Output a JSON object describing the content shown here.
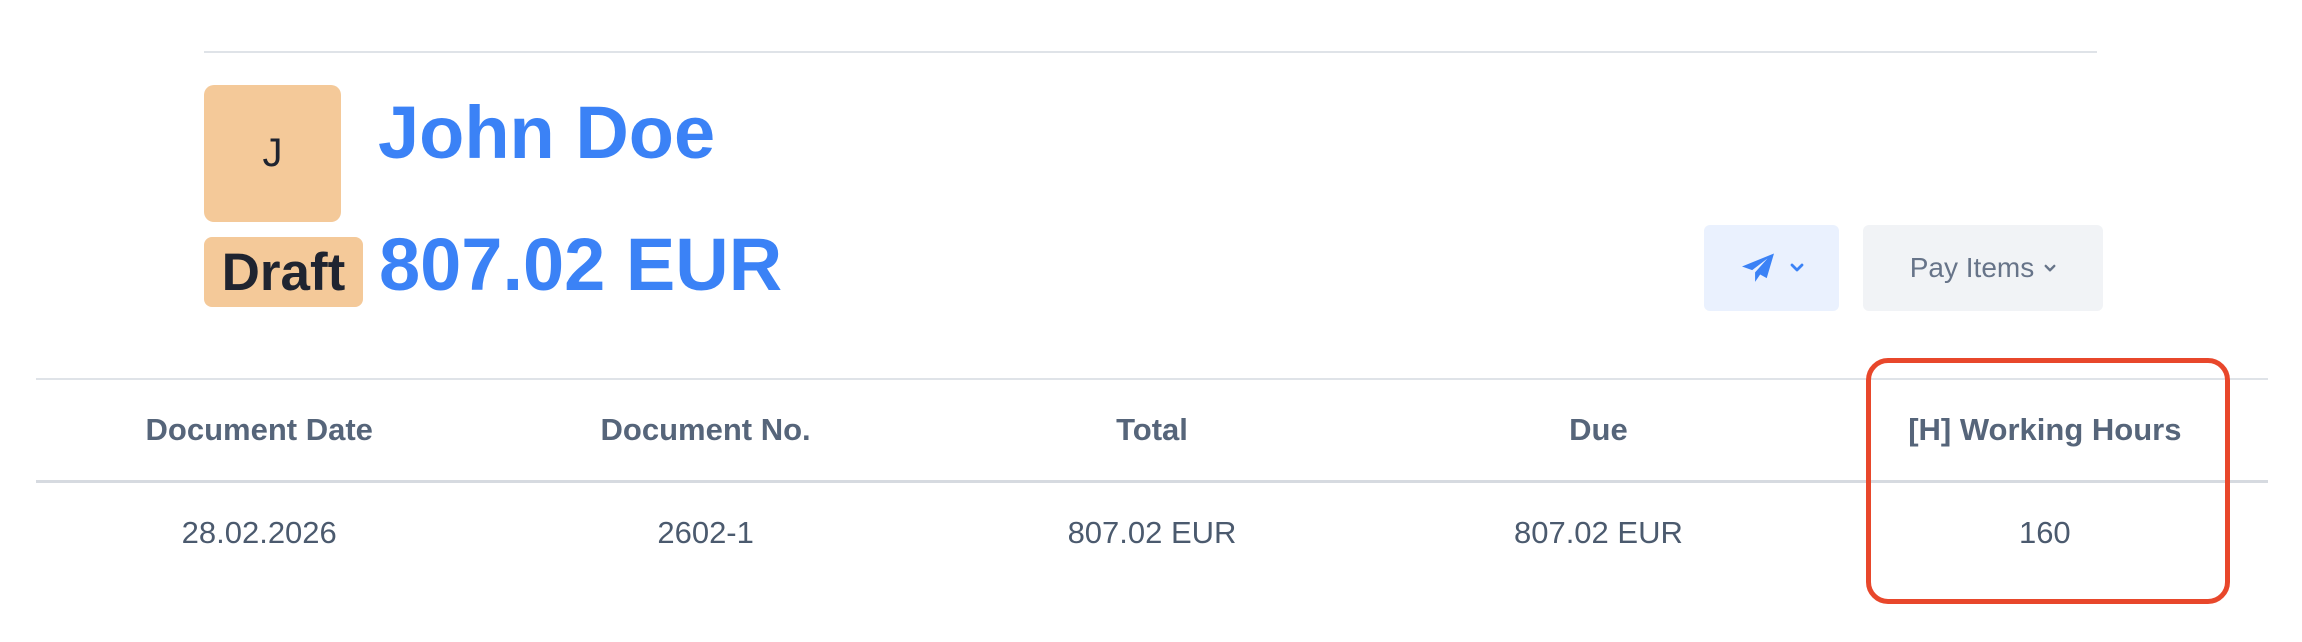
{
  "invoice": {
    "avatar_initial": "J",
    "client_name": "John Doe",
    "status": "Draft",
    "amount": "807.02 EUR"
  },
  "actions": {
    "send_icon": "paper-plane-icon",
    "send_dropdown_icon": "chevron-down-icon",
    "pay_items_label": "Pay Items",
    "pay_items_dropdown_icon": "chevron-down-icon"
  },
  "table": {
    "headers": [
      "Document Date",
      "Document No.",
      "Total",
      "Due",
      "[H] Working Hours"
    ],
    "rows": [
      [
        "28.02.2026",
        "2602-1",
        "807.02 EUR",
        "807.02 EUR",
        "160"
      ]
    ]
  },
  "colors": {
    "accent": "#3b82f6",
    "badge_bg": "#f4c999",
    "highlight": "#e8472b"
  }
}
